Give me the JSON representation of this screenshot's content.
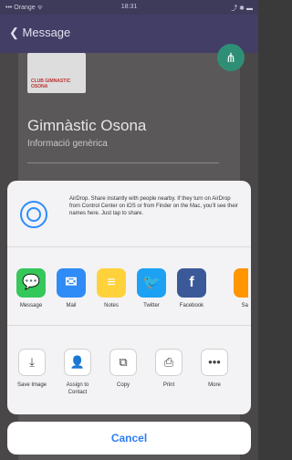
{
  "status_bar": {
    "carrier": "••• Orange ᯤ",
    "time": "18:31",
    "right": "⤴ ✱ ▬"
  },
  "nav": {
    "back_label": "Message"
  },
  "club": {
    "logo_text": "CLUB GIMNASTIC OSONA",
    "title": "Gimnàstic Osona",
    "subtitle": "Informació genèrica"
  },
  "share_sheet": {
    "airdrop_text": "AirDrop. Share instantly with people nearby. If they turn on AirDrop from Control Center on iOS or from Finder on the Mac, you'll see their names here. Just tap to share.",
    "apps": [
      {
        "label": "Message"
      },
      {
        "label": "Mail"
      },
      {
        "label": "Notes"
      },
      {
        "label": "Twitter"
      },
      {
        "label": "Facebook"
      },
      {
        "label": "Sa"
      }
    ],
    "actions": [
      {
        "label": "Save Image"
      },
      {
        "label": "Assign to Contact"
      },
      {
        "label": "Copy"
      },
      {
        "label": "Print"
      },
      {
        "label": "More"
      }
    ],
    "cancel_label": "Cancel"
  }
}
